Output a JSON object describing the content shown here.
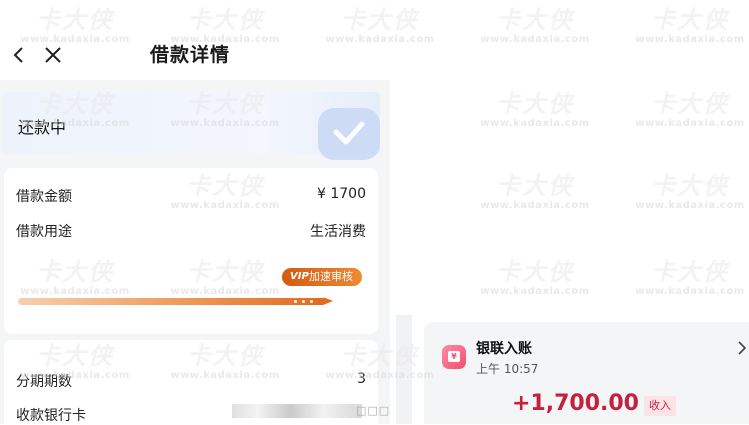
{
  "header": {
    "title": "借款详情",
    "back_icon": "chevron-left-icon",
    "close_icon": "close-icon"
  },
  "status": {
    "text": "还款中",
    "badge_icon": "check-icon"
  },
  "loan_info": {
    "amount_label": "借款金额",
    "amount_value": "¥ 1700",
    "purpose_label": "借款用途",
    "purpose_value": "生活消费",
    "review_badge_prefix": "VIP",
    "review_badge_text": "加速审核中",
    "review_progress": 0.97
  },
  "installment": {
    "periods_label": "分期期数",
    "periods_value": "3",
    "bank_card_label": "收款银行卡",
    "bank_card_masked_suffix": "□□□"
  },
  "notification": {
    "icon": "yuan-card-icon",
    "icon_glyph": "¥",
    "title": "银联入账",
    "time": "上午 10:57",
    "amount": "+1,700.00",
    "tag": "收入"
  },
  "watermark": {
    "logo": "卡大侠",
    "url": "www.kadaxia.com"
  },
  "colors": {
    "accent_orange": "#e06a1f",
    "amount_red": "#c4213d",
    "status_bg": "#eef3fb"
  }
}
